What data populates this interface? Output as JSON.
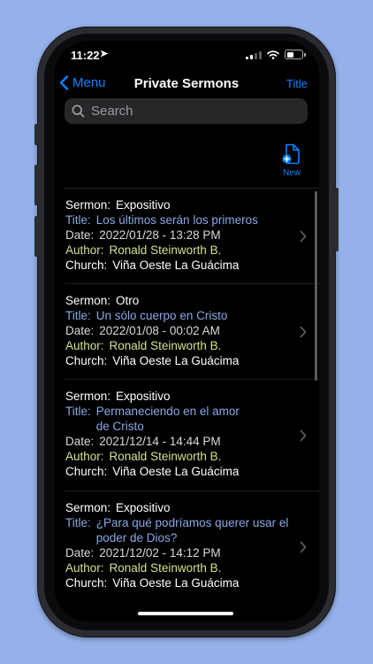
{
  "status_bar": {
    "time": "11:22",
    "location_glyph": "➤"
  },
  "navbar": {
    "back_label": "Menu",
    "title": "Private Sermons",
    "right_label": "Title"
  },
  "search": {
    "placeholder": "Search",
    "value": ""
  },
  "toolbar": {
    "new_label": "New"
  },
  "labels": {
    "type": "Sermon:",
    "title": "Title:",
    "date": "Date:",
    "author": "Author:",
    "church": "Church:"
  },
  "sermons": [
    {
      "type": "Expositivo",
      "title": "Los últimos serán los primeros",
      "date": "2022/01/28 - 13:28 PM",
      "author": "Ronald Steinworth B.",
      "church": "Viña Oeste La Guácima"
    },
    {
      "type": "Otro",
      "title": "Un sólo cuerpo en Cristo",
      "date": "2022/01/08 - 00:02 AM",
      "author": "Ronald Steinworth B.",
      "church": "Viña Oeste La Guácima"
    },
    {
      "type": "Expositivo",
      "title": "Permaneciendo en el amor de Cristo",
      "date": "2021/12/14 - 14:44 PM",
      "author": "Ronald Steinworth B.",
      "church": "Viña Oeste La Guácima"
    },
    {
      "type": "Expositivo",
      "title": "¿Para qué podríamos querer usar el poder de Dios?",
      "date": "2021/12/02 - 14:12 PM",
      "author": "Ronald Steinworth B.",
      "church": "Viña Oeste La Guácima"
    }
  ],
  "colors": {
    "accent": "#0a84ff",
    "title_text": "#89a8e6",
    "author_text": "#d8e08a",
    "background": "#96b1ea"
  },
  "icons": {
    "back": "chevron-left-icon",
    "search": "magnifier-icon",
    "new": "document-plus-icon",
    "disclosure": "chevron-right-icon"
  }
}
